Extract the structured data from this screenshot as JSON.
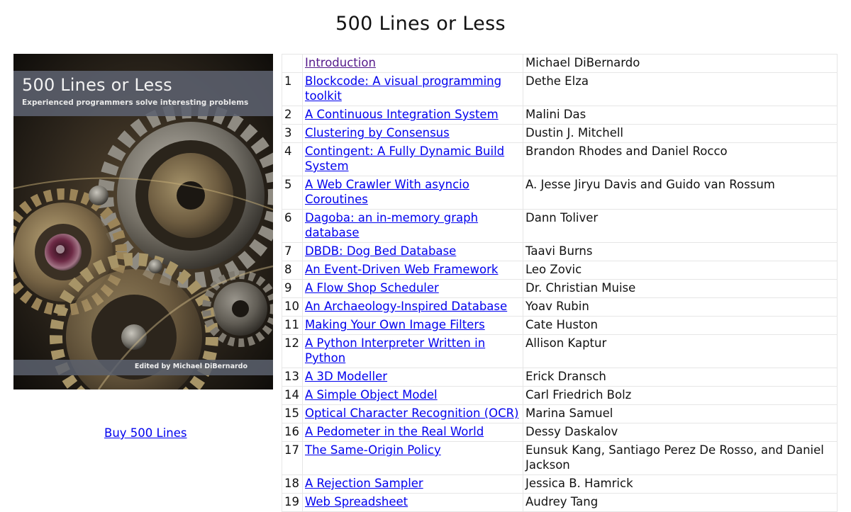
{
  "page": {
    "title": "500 Lines or Less"
  },
  "cover": {
    "title": "500 Lines or Less",
    "subtitle": "Experienced programmers solve interesting problems",
    "editor": "Edited by Michael DiBernardo"
  },
  "buy": {
    "label": "Buy 500 Lines"
  },
  "colors": {
    "link": "#0000ee",
    "visited_link": "#551a8b",
    "cover_band": "#5c616e"
  },
  "chapters": [
    {
      "num": "",
      "title": "Introduction",
      "author": "Michael DiBernardo",
      "visited": true
    },
    {
      "num": "1",
      "title": "Blockcode: A visual programming toolkit",
      "author": "Dethe Elza"
    },
    {
      "num": "2",
      "title": "A Continuous Integration System",
      "author": "Malini Das"
    },
    {
      "num": "3",
      "title": "Clustering by Consensus",
      "author": "Dustin J. Mitchell"
    },
    {
      "num": "4",
      "title": "Contingent: A Fully Dynamic Build System",
      "author": "Brandon Rhodes and Daniel Rocco"
    },
    {
      "num": "5",
      "title": "A Web Crawler With asyncio Coroutines",
      "author": "A. Jesse Jiryu Davis and Guido van Rossum"
    },
    {
      "num": "6",
      "title": "Dagoba: an in-memory graph database",
      "author": "Dann Toliver"
    },
    {
      "num": "7",
      "title": "DBDB: Dog Bed Database",
      "author": "Taavi Burns"
    },
    {
      "num": "8",
      "title": "An Event-Driven Web Framework",
      "author": "Leo Zovic"
    },
    {
      "num": "9",
      "title": "A Flow Shop Scheduler",
      "author": "Dr. Christian Muise"
    },
    {
      "num": "10",
      "title": "An Archaeology-Inspired Database",
      "author": "Yoav Rubin"
    },
    {
      "num": "11",
      "title": "Making Your Own Image Filters",
      "author": "Cate Huston"
    },
    {
      "num": "12",
      "title": "A Python Interpreter Written in Python",
      "author": "Allison Kaptur"
    },
    {
      "num": "13",
      "title": "A 3D Modeller",
      "author": "Erick Dransch"
    },
    {
      "num": "14",
      "title": "A Simple Object Model",
      "author": "Carl Friedrich Bolz"
    },
    {
      "num": "15",
      "title": "Optical Character Recognition (OCR)",
      "author": "Marina Samuel"
    },
    {
      "num": "16",
      "title": "A Pedometer in the Real World",
      "author": "Dessy Daskalov"
    },
    {
      "num": "17",
      "title": "The Same-Origin Policy",
      "author": "Eunsuk Kang, Santiago Perez De Rosso, and Daniel Jackson"
    },
    {
      "num": "18",
      "title": "A Rejection Sampler",
      "author": "Jessica B. Hamrick"
    },
    {
      "num": "19",
      "title": "Web Spreadsheet",
      "author": "Audrey Tang"
    }
  ]
}
